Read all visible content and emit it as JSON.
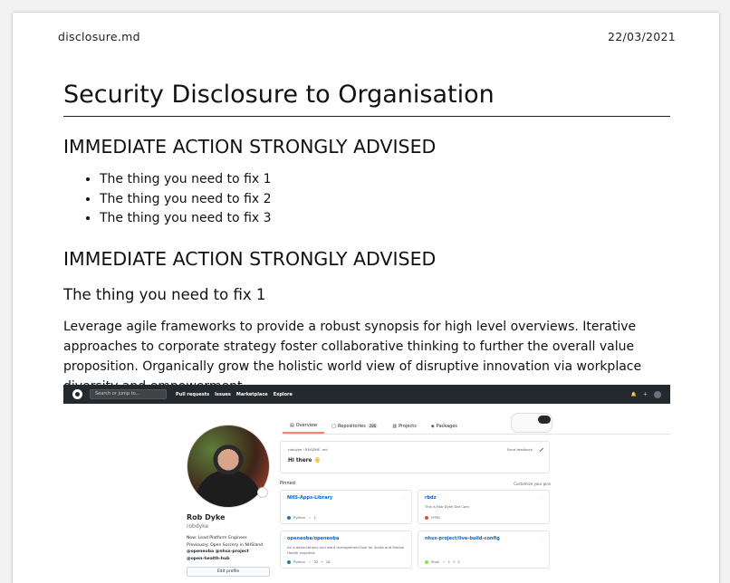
{
  "header": {
    "filename": "disclosure.md",
    "date": "22/03/2021"
  },
  "doc": {
    "title": "Security Disclosure to Organisation",
    "section1_heading": "IMMEDIATE ACTION STRONGLY ADVISED",
    "list": [
      "The thing you need to fix 1",
      "The thing you need to fix 2",
      "The thing you need to fix 3"
    ],
    "section2_heading": "IMMEDIATE ACTION STRONGLY ADVISED",
    "subheading": "The thing you need to fix 1",
    "paragraph": "Leverage agile frameworks to provide a robust synopsis for high level overviews. Iterative approaches to corporate strategy foster collaborative thinking to further the overall value proposition. Organically grow the holistic world view of disruptive innovation via workplace diversity and empowerment."
  },
  "screenshot": {
    "nav": {
      "search_placeholder": "Search or jump to...",
      "links": [
        "Pull requests",
        "Issues",
        "Marketplace",
        "Explore"
      ]
    },
    "tabs": [
      {
        "label": "Overview"
      },
      {
        "label": "Repositories",
        "count": "286"
      },
      {
        "label": "Projects"
      },
      {
        "label": "Packages"
      }
    ],
    "profile": {
      "name": "Rob Dyke",
      "login": "robdyke",
      "bio_line1": "Now: Lead Platform Engineer.",
      "bio_line2": "Previously: Open Sorcery in NHSland",
      "bio_line3": "@openeoba @nhsx-project",
      "bio_line4": "@open-health-hub",
      "edit_label": "Edit profile"
    },
    "readme": {
      "path": "robdyke / README .md",
      "send": "Send feedback",
      "greeting": "Hi there 👋"
    },
    "pinned_label": "Pinned",
    "customize_label": "Customize your pins",
    "cards": [
      {
        "title": "NHS-Apps-Library",
        "desc": "",
        "lang": "Python",
        "lang_color": "#3572A5",
        "stars": "1",
        "forks": ""
      },
      {
        "title": "rbdz",
        "desc": "This is Rob Dyke Dot Com",
        "lang": "HTML",
        "lang_color": "#e34c26",
        "stars": "",
        "forks": ""
      },
      {
        "title": "openeoba/openeoba",
        "desc": "An e-observations and ward management tool for Acute and Mental Health hospitals",
        "lang": "Python",
        "lang_color": "#3572A5",
        "stars": "32",
        "forks": "18"
      },
      {
        "title": "nhsx-project/live-build-config",
        "desc": "",
        "lang": "Shell",
        "lang_color": "#89e051",
        "stars": "1",
        "forks": "2"
      }
    ],
    "colors": {
      "nav_bg": "#24292e",
      "active_tab": "#f9826c",
      "link": "#0366d6"
    }
  }
}
